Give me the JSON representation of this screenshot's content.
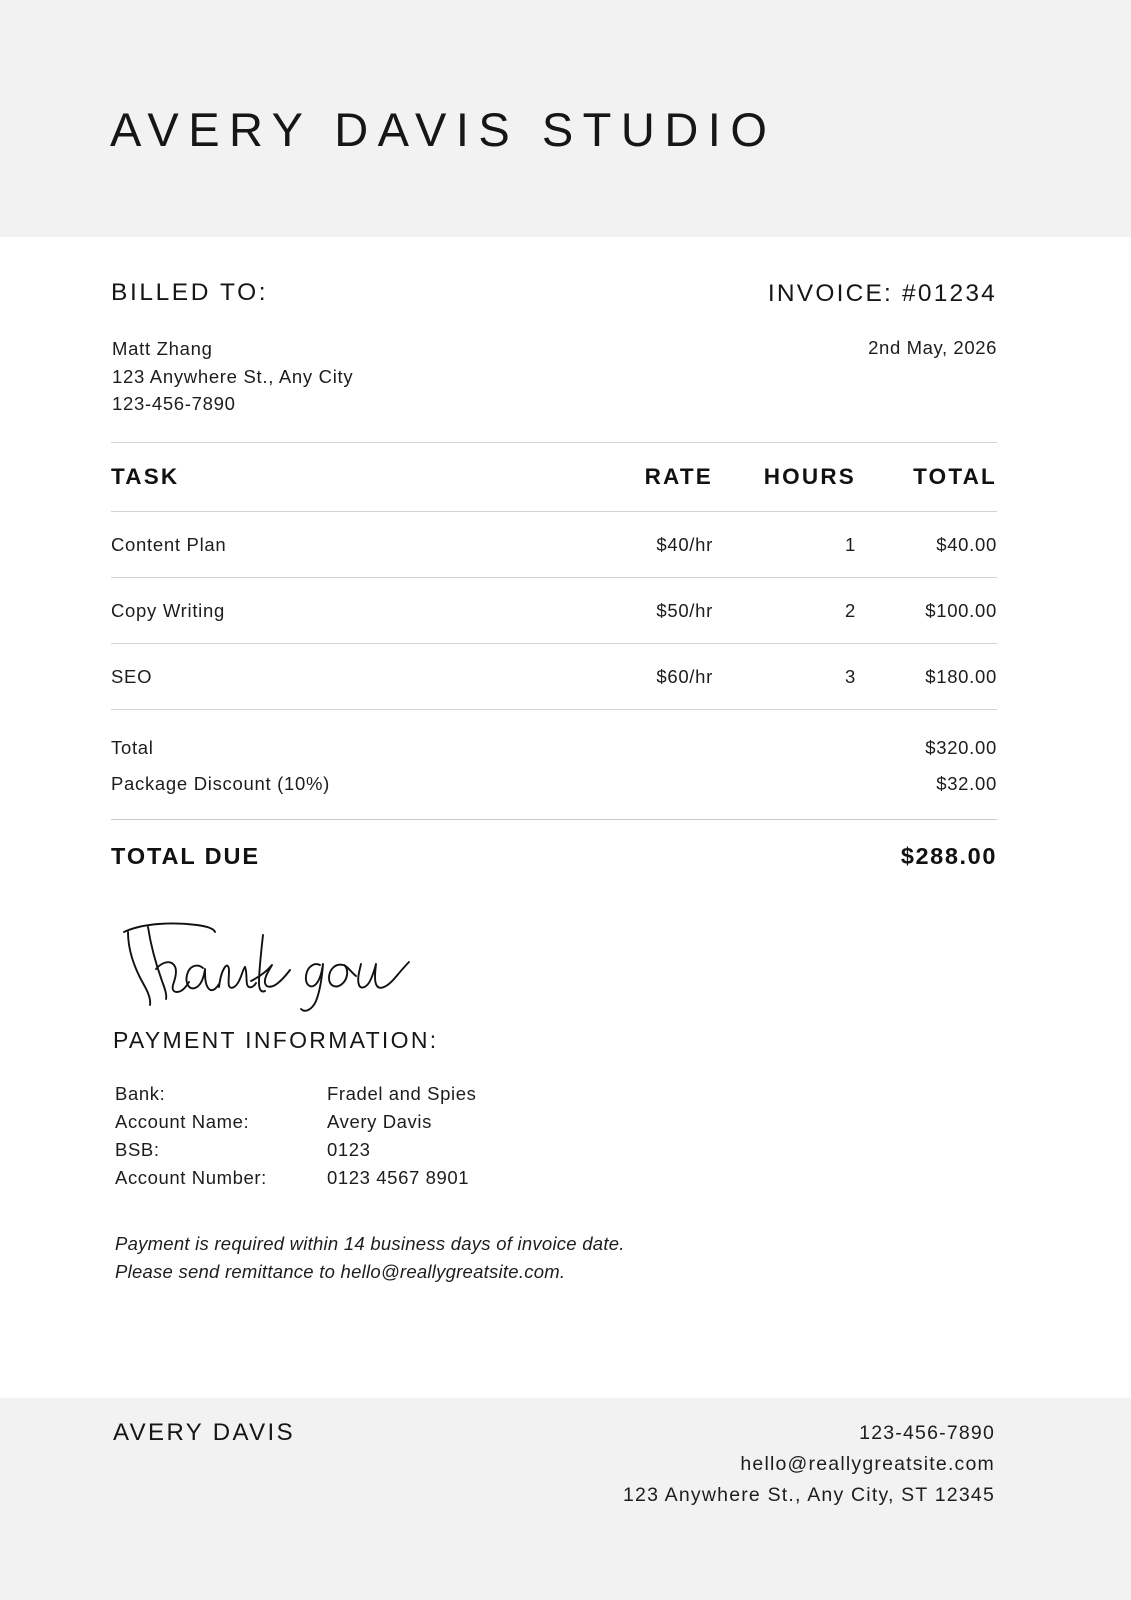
{
  "header": {
    "brand_title": "AVERY DAVIS STUDIO",
    "background_color": "#f2f2f2"
  },
  "billed_to": {
    "label": "BILLED TO:",
    "name": "Matt Zhang",
    "address": "123 Anywhere St., Any City",
    "phone": "123-456-7890"
  },
  "invoice": {
    "number_label": "INVOICE: #01234",
    "date": "2nd May, 2026"
  },
  "table": {
    "headers": {
      "task": "TASK",
      "rate": "RATE",
      "hours": "HOURS",
      "total": "TOTAL"
    },
    "rows": [
      {
        "task": "Content Plan",
        "rate": "$40/hr",
        "hours": "1",
        "total": "$40.00"
      },
      {
        "task": "Copy Writing",
        "rate": "$50/hr",
        "hours": "2",
        "total": "$100.00"
      },
      {
        "task": "SEO",
        "rate": "$60/hr",
        "hours": "3",
        "total": "$180.00"
      }
    ]
  },
  "summary": {
    "total_label": "Total",
    "total_value": "$320.00",
    "discount_label": "Package Discount (10%)",
    "discount_value": "$32.00",
    "due_label": "TOTAL DUE",
    "due_value": "$288.00"
  },
  "thank_you": {
    "text": "Thank you"
  },
  "payment": {
    "title": "PAYMENT INFORMATION:",
    "fields": [
      {
        "key": "Bank:",
        "value": "Fradel and Spies"
      },
      {
        "key": "Account Name:",
        "value": "Avery Davis"
      },
      {
        "key": "BSB:",
        "value": "0123"
      },
      {
        "key": "Account Number:",
        "value": "0123 4567 8901"
      }
    ],
    "note_line_1": "Payment is required within 14 business days of invoice date.",
    "note_line_2": "Please send remittance to hello@reallygreatsite.com."
  },
  "footer": {
    "name": "AVERY DAVIS",
    "phone": "123-456-7890",
    "email": "hello@reallygreatsite.com",
    "address": "123 Anywhere St., Any City, ST 12345",
    "background_color": "#f2f2f2"
  }
}
